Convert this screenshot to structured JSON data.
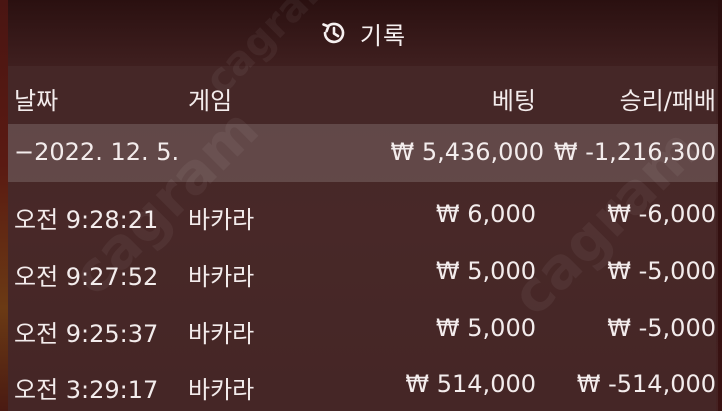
{
  "header": {
    "title": "기록",
    "icon": "history-icon"
  },
  "columns": {
    "date": "날짜",
    "game": "게임",
    "bet": "베팅",
    "winloss": "승리/패배"
  },
  "summary": {
    "date": "−2022. 12. 5.",
    "bet": "₩ 5,436,000",
    "winloss": "₩ -1,216,300"
  },
  "rows": [
    {
      "time": "오전 9:28:21",
      "game": "바카라",
      "bet": "₩ 6,000",
      "winloss": "₩ -6,000"
    },
    {
      "time": "오전 9:27:52",
      "game": "바카라",
      "bet": "₩ 5,000",
      "winloss": "₩ -5,000"
    },
    {
      "time": "오전 9:25:37",
      "game": "바카라",
      "bet": "₩ 5,000",
      "winloss": "₩ -5,000"
    },
    {
      "time": "오전 3:29:17",
      "game": "바카라",
      "bet": "₩ 514,000",
      "winloss": "₩ -514,000"
    }
  ],
  "watermark": "cagram",
  "colors": {
    "background": "#3a1b1c",
    "summary_row": "#7a6464",
    "text": "#f3ecec"
  }
}
